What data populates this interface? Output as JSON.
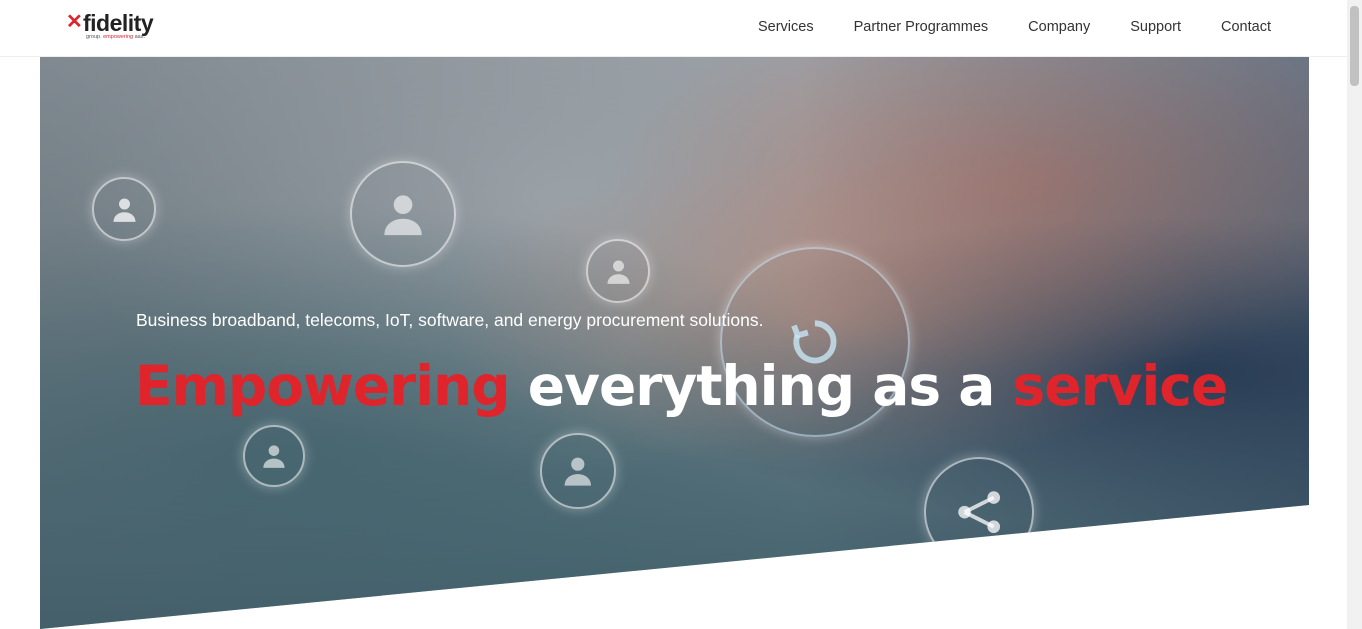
{
  "brand": {
    "mark": "✕",
    "name": "fidelity",
    "tagline_prefix": "group. ",
    "tagline_accent": "empowering",
    "tagline_suffix": " aas."
  },
  "nav": {
    "items": [
      {
        "label": "Services"
      },
      {
        "label": "Partner Programmes"
      },
      {
        "label": "Company"
      },
      {
        "label": "Support"
      },
      {
        "label": "Contact"
      }
    ]
  },
  "hero": {
    "subtitle": "Business broadband, telecoms, IoT, software, and energy procurement solutions.",
    "title_part1": "Empowering",
    "title_part2": " everything as a ",
    "title_part3": "service"
  },
  "icons": [
    "user-icon",
    "user-icon",
    "user-icon",
    "user-icon",
    "user-icon",
    "refresh-icon",
    "share-icon"
  ],
  "colors": {
    "accent": "#e0242b",
    "text": "#333333",
    "header_bg": "#ffffff"
  }
}
